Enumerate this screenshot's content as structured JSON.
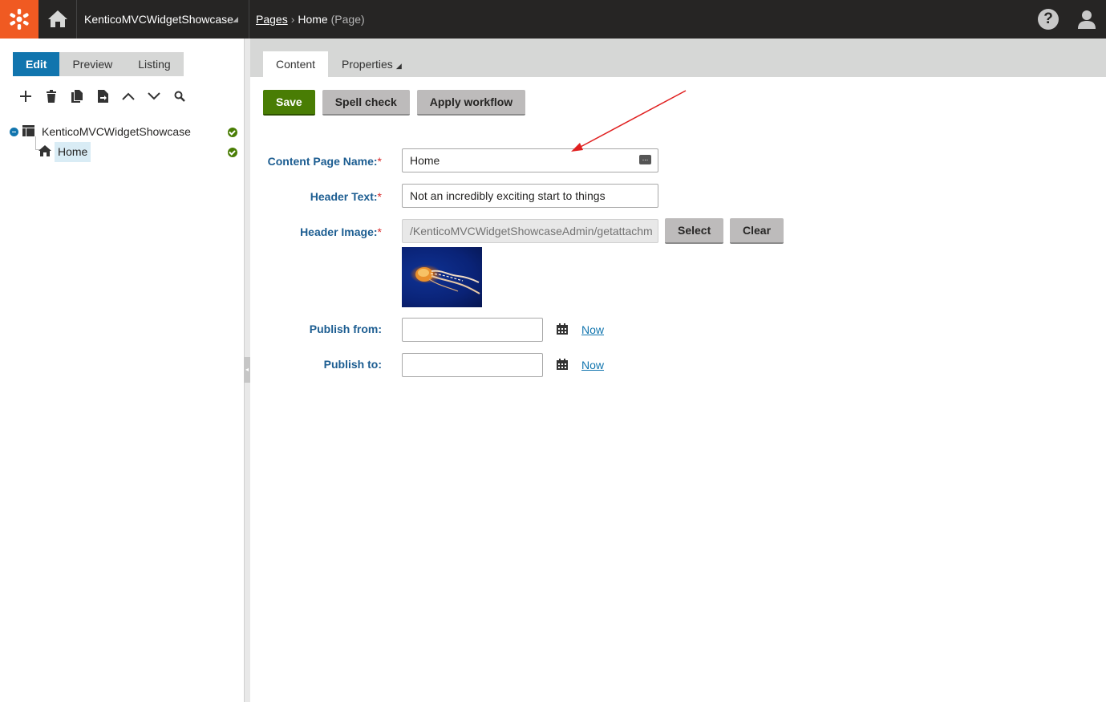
{
  "header": {
    "site_name": "KenticoMVCWidgetShowcase",
    "breadcrumb_root": "Pages",
    "breadcrumb_current": "Home",
    "breadcrumb_type": "(Page)",
    "help_label": "?"
  },
  "leftpane": {
    "modes": [
      "Edit",
      "Preview",
      "Listing"
    ],
    "active_mode": "Edit",
    "tree": {
      "root": "KenticoMVCWidgetShowcase",
      "child": "Home"
    }
  },
  "tabs": {
    "content": "Content",
    "properties": "Properties"
  },
  "actions": {
    "save": "Save",
    "spell_check": "Spell check",
    "apply_workflow": "Apply workflow"
  },
  "form": {
    "page_name_label": "Content Page Name:",
    "page_name_value": "Home",
    "header_text_label": "Header Text:",
    "header_text_value": "Not an incredibly exciting start to things",
    "header_image_label": "Header Image:",
    "header_image_value": "/KenticoMVCWidgetShowcaseAdmin/getattachm",
    "select_label": "Select",
    "clear_label": "Clear",
    "publish_from_label": "Publish from:",
    "publish_to_label": "Publish to:",
    "now_label": "Now",
    "required_marker": "*",
    "ellipsis": "..."
  },
  "colors": {
    "brand": "#f05a22",
    "primary_blue": "#1175ae",
    "success_green": "#497d04",
    "label_blue": "#1c5d91"
  }
}
